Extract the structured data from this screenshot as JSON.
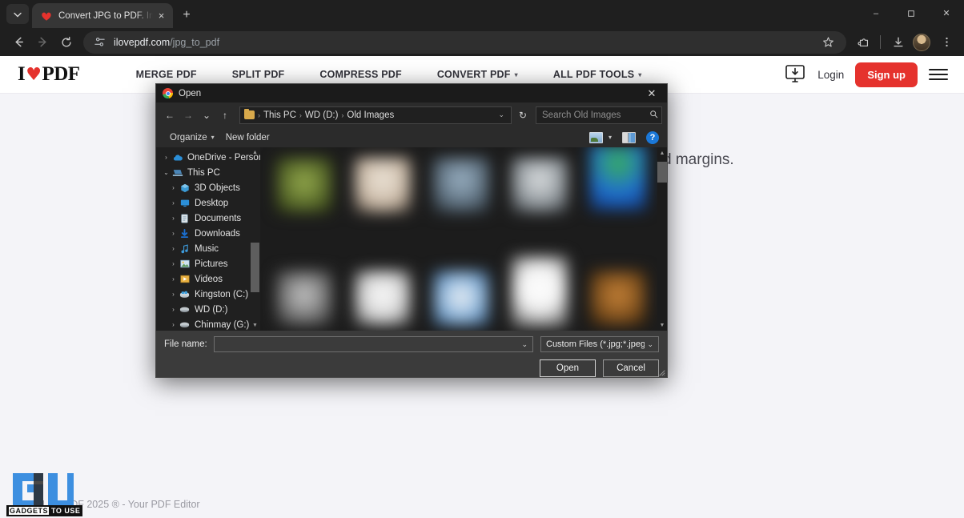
{
  "browser": {
    "tab": {
      "title": "Convert JPG to PDF. Images JPG to PDF",
      "favicon": "ilovepdf-heart-icon",
      "close": "×"
    },
    "new_tab": "+",
    "tab_list": "chevron-down-icon",
    "window_controls": {
      "minimize": "–",
      "maximize": "❐",
      "close": "✕"
    },
    "nav": {
      "back": "←",
      "forward": "→",
      "reload": "⟳"
    },
    "omnibox": {
      "site_settings_icon": "tune-icon",
      "url_domain": "ilovepdf.com",
      "url_path": "/jpg_to_pdf",
      "bookmark_icon": "star-icon"
    },
    "toolbar_icons": [
      "extensions-icon",
      "downloads-icon",
      "profile-avatar",
      "chrome-menu-icon"
    ]
  },
  "site": {
    "logo": {
      "pre": "I",
      "heart": "♥",
      "post": "PDF"
    },
    "nav_links": [
      {
        "label": "MERGE PDF",
        "caret": false
      },
      {
        "label": "SPLIT PDF",
        "caret": false
      },
      {
        "label": "COMPRESS PDF",
        "caret": false
      },
      {
        "label": "CONVERT PDF",
        "caret": true
      },
      {
        "label": "ALL PDF TOOLS",
        "caret": true
      }
    ],
    "caret_glyph": "▾",
    "desktop_app_icon": "desktop-download-icon",
    "login_label": "Login",
    "signup_label": "Sign up",
    "menu_icon": "hamburger-menu-icon",
    "page_copy": "d margins.",
    "footer_text": "iLovePDF 2025 ® - Your PDF Editor",
    "accent_color": "#e5322d"
  },
  "watermark": {
    "logo": "GU",
    "label_a": "GADGETS",
    "label_b": "TO USE"
  },
  "dialog": {
    "title": "Open",
    "title_icon": "chrome-logo-icon",
    "close_glyph": "✕",
    "nav": {
      "back": "←",
      "forward": "→",
      "recent": "⌄",
      "up": "↑",
      "refresh": "↻",
      "dropdown": "⌄"
    },
    "breadcrumb": {
      "folder_icon": "folder-icon",
      "segments": [
        "This PC",
        "WD (D:)",
        "Old Images"
      ],
      "separator": "›"
    },
    "search": {
      "placeholder": "Search Old Images",
      "icon": "magnifier-icon"
    },
    "commands": {
      "organize": "Organize",
      "organize_caret": "▾",
      "new_folder": "New folder",
      "view_icon": "view-layout-icon",
      "view_caret": "▾",
      "preview_pane_icon": "preview-pane-icon",
      "help": "?"
    },
    "sidebar": [
      {
        "label": "OneDrive - Person",
        "icon": "onedrive-cloud-icon",
        "expander": "›",
        "indent": false,
        "expanded": false
      },
      {
        "label": "This PC",
        "icon": "this-pc-icon",
        "expander": "⌄",
        "indent": false,
        "expanded": true
      },
      {
        "label": "3D Objects",
        "icon": "3d-objects-icon",
        "expander": "›",
        "indent": true,
        "expanded": false
      },
      {
        "label": "Desktop",
        "icon": "desktop-icon",
        "expander": "›",
        "indent": true,
        "expanded": false
      },
      {
        "label": "Documents",
        "icon": "documents-icon",
        "expander": "›",
        "indent": true,
        "expanded": false
      },
      {
        "label": "Downloads",
        "icon": "downloads-arrow-icon",
        "expander": "›",
        "indent": true,
        "expanded": false
      },
      {
        "label": "Music",
        "icon": "music-note-icon",
        "expander": "›",
        "indent": true,
        "expanded": false
      },
      {
        "label": "Pictures",
        "icon": "pictures-icon",
        "expander": "›",
        "indent": true,
        "expanded": false
      },
      {
        "label": "Videos",
        "icon": "videos-icon",
        "expander": "›",
        "indent": true,
        "expanded": false
      },
      {
        "label": "Kingston (C:)",
        "icon": "windows-drive-icon",
        "expander": "›",
        "indent": true,
        "expanded": false
      },
      {
        "label": "WD (D:)",
        "icon": "drive-icon",
        "expander": "›",
        "indent": true,
        "expanded": false
      },
      {
        "label": "Chinmay (G:)",
        "icon": "drive-icon",
        "expander": "›",
        "indent": true,
        "expanded": false
      }
    ],
    "scroll": {
      "up": "▲",
      "down": "▼"
    },
    "thumbnails": [
      {
        "color": "#7a8f3c"
      },
      {
        "color": "#ded7cc"
      },
      {
        "color": "#8fa8bd"
      },
      {
        "color": "#cfd2d4"
      },
      {
        "color": "#2f6fd0"
      },
      {
        "color": "#9a9a9a"
      },
      {
        "color": "#f0f0f0"
      },
      {
        "color": "#7fa9d8"
      },
      {
        "color": "#ffffff"
      },
      {
        "color": "#b0712c"
      }
    ],
    "footer": {
      "file_name_label": "File name:",
      "file_name_value": "",
      "file_name_caret": "⌄",
      "file_type_value": "Custom Files (*.jpg;*.jpeg;*.png;",
      "file_type_caret": "⌄",
      "open_label": "Open",
      "cancel_label": "Cancel"
    }
  }
}
